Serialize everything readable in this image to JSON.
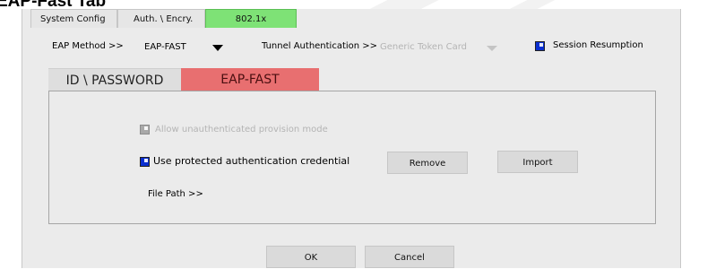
{
  "heading": "EAP-Fast Tab",
  "top_tabs": [
    {
      "label": "System Config",
      "active": false
    },
    {
      "label": "Auth. \\ Encry.",
      "active": false
    },
    {
      "label": "802.1x",
      "active": true
    }
  ],
  "eap_method": {
    "label": "EAP Method >>",
    "value": "EAP-FAST"
  },
  "tunnel_auth": {
    "label": "Tunnel Authentication >>",
    "value": "Generic Token Card"
  },
  "session_resumption": {
    "label": "Session Resumption",
    "checked": true
  },
  "sub_tabs": [
    {
      "label": "ID \\ PASSWORD",
      "active": false
    },
    {
      "label": "EAP-FAST",
      "active": true
    }
  ],
  "eap_fast": {
    "allow_unauth_label": "Allow unauthenticated provision mode",
    "allow_unauth_enabled": false,
    "use_protected_label": "Use protected authentication credential",
    "use_protected_checked": true,
    "remove_label": "Remove",
    "import_label": "Import",
    "file_path_label": "File Path >>"
  },
  "ok_label": "OK",
  "cancel_label": "Cancel",
  "colors": {
    "active_tab": "#7ee276",
    "active_subtab": "#e86f70",
    "checkbox": "#0a2fd0"
  }
}
